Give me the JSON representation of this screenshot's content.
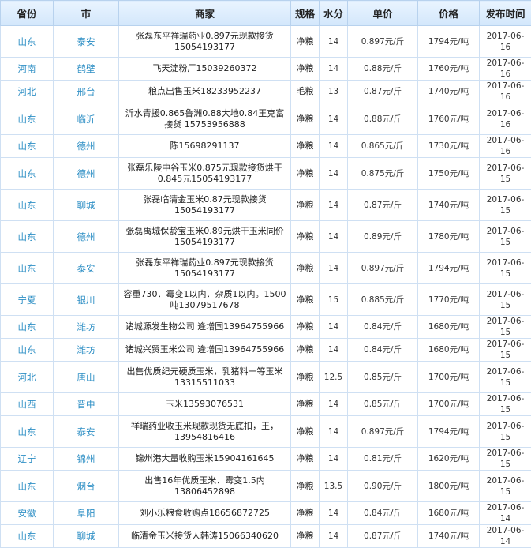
{
  "headers": {
    "province": "省份",
    "city": "市",
    "merchant": "商家",
    "spec": "规格",
    "moisture": "水分",
    "unit_price": "单价",
    "price": "价格",
    "date": "发布时间"
  },
  "rows": [
    {
      "province": "山东",
      "city": "泰安",
      "merchant": "张磊东平祥瑞药业0.897元现款接货15054193177",
      "spec": "净粮",
      "moisture": "14",
      "unit_price": "0.897元/斤",
      "price": "1794元/吨",
      "date": "2017-06-16",
      "tall": true
    },
    {
      "province": "河南",
      "city": "鹤壁",
      "merchant": "飞天淀粉厂15039260372",
      "spec": "净粮",
      "moisture": "14",
      "unit_price": "0.88元/斤",
      "price": "1760元/吨",
      "date": "2017-06-16",
      "tall": false
    },
    {
      "province": "河北",
      "city": "邢台",
      "merchant": "粮点出售玉米18233952237",
      "spec": "毛粮",
      "moisture": "13",
      "unit_price": "0.87元/斤",
      "price": "1740元/吨",
      "date": "2017-06-16",
      "tall": false
    },
    {
      "province": "山东",
      "city": "临沂",
      "merchant": "沂水青援0.865鲁洲0.88大地0.84王克富接货 15753956888",
      "spec": "净粮",
      "moisture": "14",
      "unit_price": "0.88元/斤",
      "price": "1760元/吨",
      "date": "2017-06-16",
      "tall": true
    },
    {
      "province": "山东",
      "city": "德州",
      "merchant": "陈15698291137",
      "spec": "净粮",
      "moisture": "14",
      "unit_price": "0.865元/斤",
      "price": "1730元/吨",
      "date": "2017-06-16",
      "tall": false
    },
    {
      "province": "山东",
      "city": "德州",
      "merchant": "张磊乐陵中谷玉米0.875元现款接货烘干0.845元15054193177",
      "spec": "净粮",
      "moisture": "14",
      "unit_price": "0.875元/斤",
      "price": "1750元/吨",
      "date": "2017-06-15",
      "tall": true
    },
    {
      "province": "山东",
      "city": "聊城",
      "merchant": "张磊临清金玉米0.87元现款接货15054193177",
      "spec": "净粮",
      "moisture": "14",
      "unit_price": "0.87元/斤",
      "price": "1740元/吨",
      "date": "2017-06-15",
      "tall": true
    },
    {
      "province": "山东",
      "city": "德州",
      "merchant": "张磊禹城保龄宝玉米0.89元烘干玉米同价15054193177",
      "spec": "净粮",
      "moisture": "14",
      "unit_price": "0.89元/斤",
      "price": "1780元/吨",
      "date": "2017-06-15",
      "tall": true
    },
    {
      "province": "山东",
      "city": "泰安",
      "merchant": "张磊东平祥瑞药业0.897元现款接货15054193177",
      "spec": "净粮",
      "moisture": "14",
      "unit_price": "0.897元/斤",
      "price": "1794元/吨",
      "date": "2017-06-15",
      "tall": true
    },
    {
      "province": "宁夏",
      "city": "银川",
      "merchant": "容重730．霉变1以内．杂质1以内。1500吨13079517678",
      "spec": "净粮",
      "moisture": "15",
      "unit_price": "0.885元/斤",
      "price": "1770元/吨",
      "date": "2017-06-15",
      "tall": true
    },
    {
      "province": "山东",
      "city": "潍坊",
      "merchant": "诸城源发生物公司 逄增国13964755966",
      "spec": "净粮",
      "moisture": "14",
      "unit_price": "0.84元/斤",
      "price": "1680元/吨",
      "date": "2017-06-15",
      "tall": false
    },
    {
      "province": "山东",
      "city": "潍坊",
      "merchant": "诸城兴贸玉米公司 逄增国13964755966",
      "spec": "净粮",
      "moisture": "14",
      "unit_price": "0.84元/斤",
      "price": "1680元/吨",
      "date": "2017-06-15",
      "tall": false
    },
    {
      "province": "河北",
      "city": "唐山",
      "merchant": "出售优质纪元硬质玉米，乳猪料一等玉米13315511033",
      "spec": "净粮",
      "moisture": "12.5",
      "unit_price": "0.85元/斤",
      "price": "1700元/吨",
      "date": "2017-06-15",
      "tall": true
    },
    {
      "province": "山西",
      "city": "晋中",
      "merchant": "玉米13593076531",
      "spec": "净粮",
      "moisture": "14",
      "unit_price": "0.85元/斤",
      "price": "1700元/吨",
      "date": "2017-06-15",
      "tall": false
    },
    {
      "province": "山东",
      "city": "泰安",
      "merchant": "祥瑞药业收玉米现款现货无底扣，王，13954816416",
      "spec": "净粮",
      "moisture": "14",
      "unit_price": "0.897元/斤",
      "price": "1794元/吨",
      "date": "2017-06-15",
      "tall": true
    },
    {
      "province": "辽宁",
      "city": "锦州",
      "merchant": "锦州港大量收购玉米15904161645",
      "spec": "净粮",
      "moisture": "14",
      "unit_price": "0.81元/斤",
      "price": "1620元/吨",
      "date": "2017-06-15",
      "tall": false
    },
    {
      "province": "山东",
      "city": "烟台",
      "merchant": "出售16年优质玉米．霉变1.5内13806452898",
      "spec": "净粮",
      "moisture": "13.5",
      "unit_price": "0.90元/斤",
      "price": "1800元/吨",
      "date": "2017-06-15",
      "tall": true
    },
    {
      "province": "安徽",
      "city": "阜阳",
      "merchant": "刘小乐粮食收购点18656872725",
      "spec": "净粮",
      "moisture": "14",
      "unit_price": "0.84元/斤",
      "price": "1680元/吨",
      "date": "2017-06-14",
      "tall": false
    },
    {
      "province": "山东",
      "city": "聊城",
      "merchant": "临清金玉米接货人韩涛15066340620",
      "spec": "净粮",
      "moisture": "14",
      "unit_price": "0.87元/斤",
      "price": "1740元/吨",
      "date": "2017-06-14",
      "tall": false
    }
  ]
}
